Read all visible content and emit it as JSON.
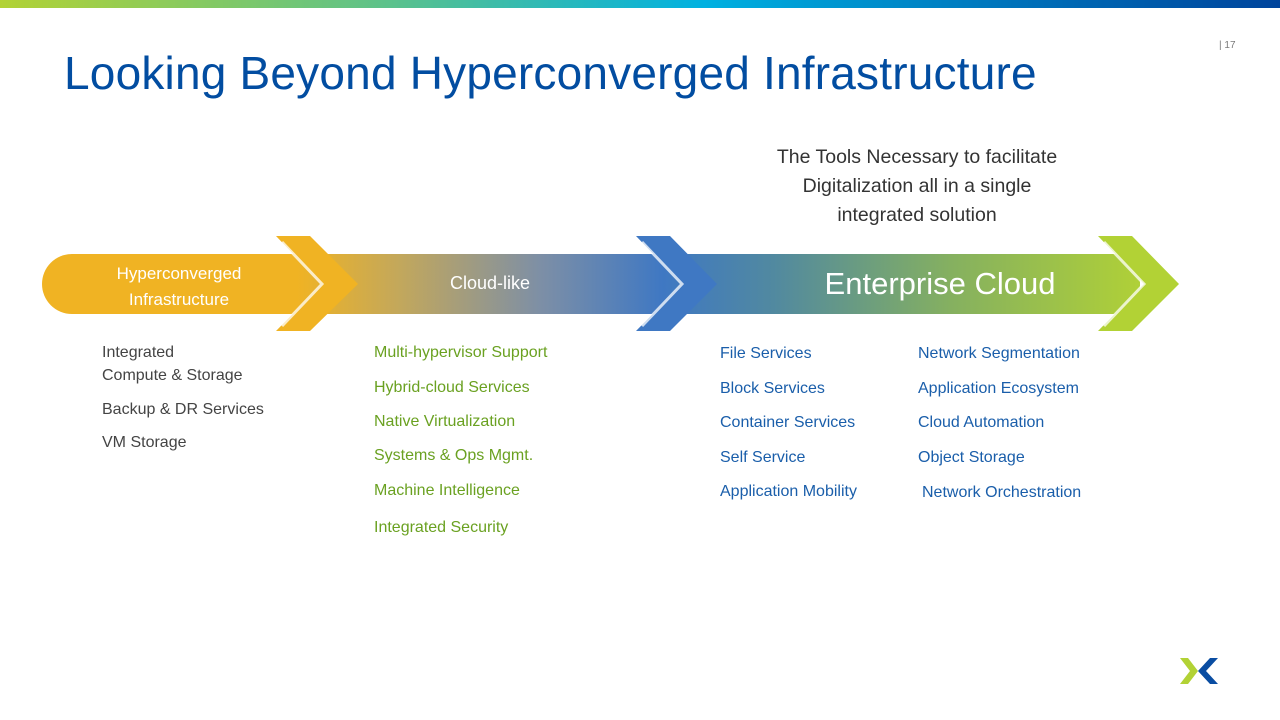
{
  "slide": {
    "title": "Looking Beyond Hyperconverged Infrastructure",
    "page_number": "| 17",
    "subtitle_lines": [
      "The Tools Necessary to facilitate",
      "Digitalization all in a single",
      "integrated solution"
    ]
  },
  "colors": {
    "title": "#024da1",
    "stage1": "#f0b323",
    "stage2": "#3f78c3",
    "stage3": "#b2d235",
    "list_gray": "#444444",
    "list_green": "#6aa121",
    "list_blue": "#1a5eaa"
  },
  "stages": [
    {
      "label_line1": "Hyperconverged",
      "label_line2": "Infrastructure"
    },
    {
      "label": "Cloud-like"
    },
    {
      "label": "Enterprise Cloud"
    }
  ],
  "lists": {
    "hci": [
      "Integrated",
      "Compute & Storage",
      "Backup & DR Services",
      "VM Storage"
    ],
    "cloud_like": [
      "Multi-hypervisor Support",
      "Hybrid-cloud Services",
      "Native Virtualization",
      "Systems & Ops Mgmt.",
      "Machine Intelligence",
      "Integrated Security"
    ],
    "enterprise_col1": [
      "File Services",
      "Block Services",
      "Container Services",
      "Self Service",
      "Application Mobility"
    ],
    "enterprise_col2": [
      "Network Segmentation",
      "Application Ecosystem",
      "Cloud Automation",
      "Object Storage",
      "Network Orchestration"
    ]
  },
  "logo": {
    "icon": "nutanix-x-logo"
  }
}
